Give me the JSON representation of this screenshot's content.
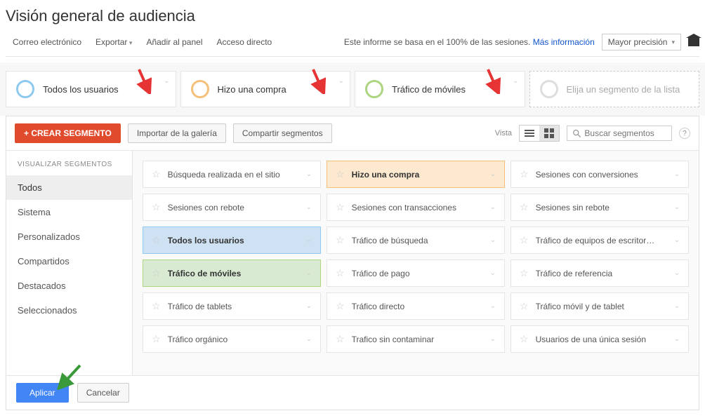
{
  "page_title": "Visión general de audiencia",
  "toolbar": {
    "email": "Correo electrónico",
    "export": "Exportar",
    "add_panel": "Añadir al panel",
    "shortcut": "Acceso directo",
    "report_note_prefix": "Este informe se basa en el 100% de las sesiones. ",
    "more_info": "Más información",
    "precision": "Mayor precisión"
  },
  "active_segments": [
    {
      "label": "Todos los usuarios",
      "color": "blue"
    },
    {
      "label": "Hizo una compra",
      "color": "orange"
    },
    {
      "label": "Tráfico de móviles",
      "color": "green"
    }
  ],
  "placeholder_segment": "Elija un segmento de la lista",
  "panel": {
    "create": "+ CREAR SEGMENTO",
    "import": "Importar de la galería",
    "share": "Compartir segmentos",
    "view_label": "Vista",
    "search_placeholder": "Buscar segmentos"
  },
  "sidebar": {
    "heading": "VISUALIZAR SEGMENTOS",
    "items": [
      "Todos",
      "Sistema",
      "Personalizados",
      "Compartidos",
      "Destacados",
      "Seleccionados"
    ],
    "active_index": 0
  },
  "segment_grid": [
    {
      "name": "Búsqueda realizada en el sitio",
      "sel": ""
    },
    {
      "name": "Hizo una compra",
      "sel": "orange"
    },
    {
      "name": "Sesiones con conversiones",
      "sel": ""
    },
    {
      "name": "Sesiones con rebote",
      "sel": ""
    },
    {
      "name": "Sesiones con transacciones",
      "sel": ""
    },
    {
      "name": "Sesiones sin rebote",
      "sel": ""
    },
    {
      "name": "Todos los usuarios",
      "sel": "blue"
    },
    {
      "name": "Tráfico de búsqueda",
      "sel": ""
    },
    {
      "name": "Tráfico de equipos de escritor…",
      "sel": ""
    },
    {
      "name": "Tráfico de móviles",
      "sel": "green"
    },
    {
      "name": "Tráfico de pago",
      "sel": ""
    },
    {
      "name": "Tráfico de referencia",
      "sel": ""
    },
    {
      "name": "Tráfico de tablets",
      "sel": ""
    },
    {
      "name": "Tráfico directo",
      "sel": ""
    },
    {
      "name": "Tráfico móvil y de tablet",
      "sel": ""
    },
    {
      "name": "Tráfico orgánico",
      "sel": ""
    },
    {
      "name": "Trafico sin contaminar",
      "sel": ""
    },
    {
      "name": "Usuarios de una única sesión",
      "sel": ""
    }
  ],
  "footer": {
    "apply": "Aplicar",
    "cancel": "Cancelar"
  }
}
